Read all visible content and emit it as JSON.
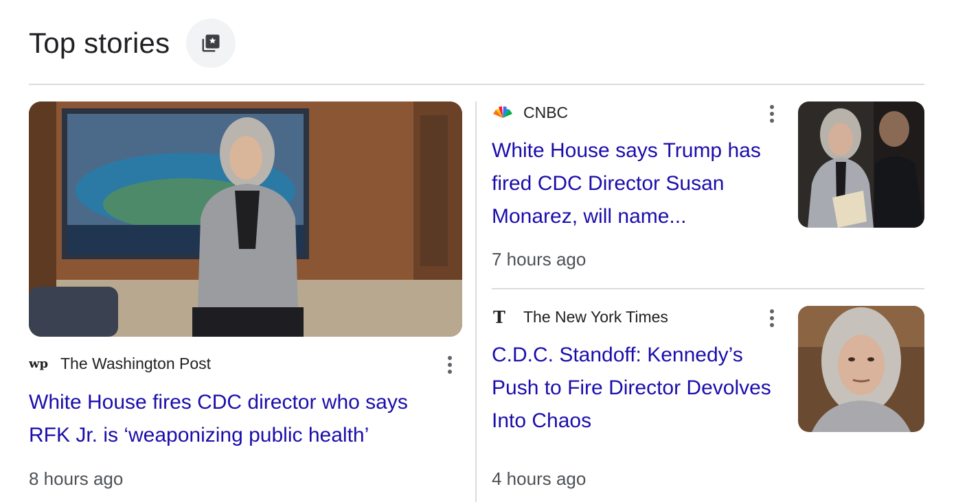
{
  "header": {
    "title": "Top stories",
    "icon": "collections-star-icon"
  },
  "stories": [
    {
      "source": "The Washington Post",
      "logo": "wp",
      "headline_lines": [
        "White House fires CDC director who says",
        "RFK Jr. is ‘weaponizing public health’"
      ],
      "time": "8 hours ago"
    },
    {
      "source": "CNBC",
      "logo": "nbc-peacock",
      "headline_lines": [
        "White House says Trump has",
        "fired CDC Director Susan",
        "Monarez, will name..."
      ],
      "time": "7 hours ago"
    },
    {
      "source": "The New York Times",
      "logo": "T",
      "headline_lines": [
        "C.D.C. Standoff: Kennedy’s",
        "Push to Fire Director Devolves",
        "Into Chaos"
      ],
      "time": "4 hours ago"
    }
  ],
  "colors": {
    "link": "#1a0dab",
    "meta": "#4d5156",
    "divider": "#dadce0"
  }
}
